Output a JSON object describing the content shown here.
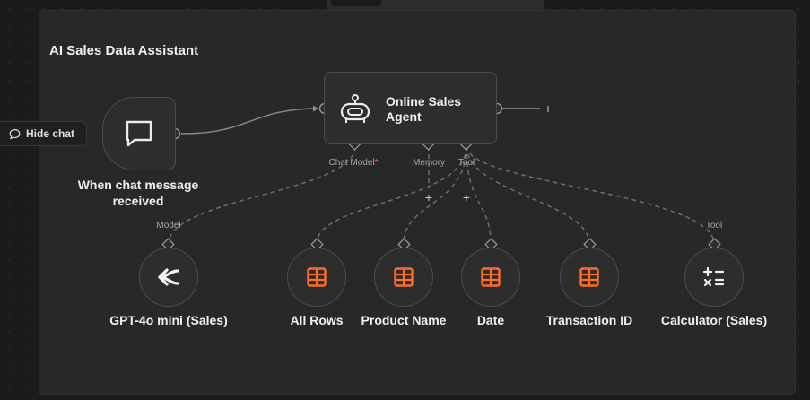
{
  "workflow": {
    "title": "AI Sales Data Assistant"
  },
  "hide_chat": {
    "label": "Hide chat"
  },
  "trigger": {
    "label": "When chat message received",
    "icon": "chat-bubble-icon"
  },
  "agent": {
    "label": "Online Sales Agent",
    "icon": "robot-icon",
    "ports": {
      "chat_model": "Chat Model",
      "memory": "Memory",
      "tool": "Tool"
    }
  },
  "model_node": {
    "label": "GPT-4o mini (Sales)",
    "port_label": "Model",
    "icon": "openai-model-icon"
  },
  "tools": [
    {
      "label": "All Rows",
      "icon": "table-icon"
    },
    {
      "label": "Product Name",
      "icon": "table-icon"
    },
    {
      "label": "Date",
      "icon": "table-icon"
    },
    {
      "label": "Transaction ID",
      "icon": "table-icon"
    },
    {
      "label": "Calculator (Sales)",
      "icon": "calculator-icon",
      "port_label": "Tool"
    }
  ],
  "colors": {
    "accent": "#ff6d2d",
    "wire": "#8a8a8a",
    "node_bg": "#2d2d2d"
  }
}
